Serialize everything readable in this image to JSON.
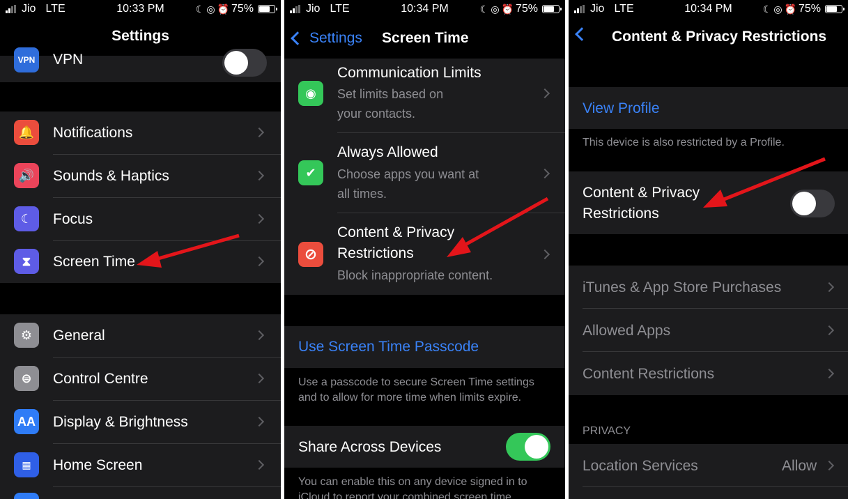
{
  "colors": {
    "accent": "#3a82f7",
    "toggle_on": "#34c759",
    "arrow": "#e3151a"
  },
  "panel1": {
    "status": {
      "carrier": "Jio",
      "network": "LTE",
      "time": "10:33 PM",
      "battery": "75%"
    },
    "title": "Settings",
    "vpn_label": "VPN",
    "items": [
      {
        "label": "Notifications",
        "icon": "notifications-icon"
      },
      {
        "label": "Sounds & Haptics",
        "icon": "sounds-icon"
      },
      {
        "label": "Focus",
        "icon": "focus-moon-icon"
      },
      {
        "label": "Screen Time",
        "icon": "hourglass-icon"
      },
      {
        "label": "General",
        "icon": "gear-icon"
      },
      {
        "label": "Control Centre",
        "icon": "control-centre-icon"
      },
      {
        "label": "Display & Brightness",
        "icon": "display-icon",
        "icon_text": "AA"
      },
      {
        "label": "Home Screen",
        "icon": "home-screen-icon"
      }
    ]
  },
  "panel2": {
    "status": {
      "carrier": "Jio",
      "network": "LTE",
      "time": "10:34 PM",
      "battery": "75%"
    },
    "back_label": "Settings",
    "title": "Screen Time",
    "items": [
      {
        "label": "Communication Limits",
        "sub1": "Set limits based on",
        "sub2": "your contacts.",
        "icon": "person-circle-icon"
      },
      {
        "label": "Always Allowed",
        "sub1": "Choose apps you want at",
        "sub2": "all times.",
        "icon": "checkmark-badge-icon"
      },
      {
        "label1": "Content & Privacy",
        "label2": "Restrictions",
        "sub": "Block inappropriate content.",
        "icon": "no-entry-icon"
      }
    ],
    "passcode_link": "Use Screen Time Passcode",
    "passcode_foot1": "Use a passcode to secure Screen Time settings",
    "passcode_foot2": "and to allow for more time when limits expire.",
    "share_label": "Share Across Devices",
    "share_on": true,
    "share_foot1": "You can enable this on any device signed in to",
    "share_foot2": "iCloud to report your combined screen time."
  },
  "panel3": {
    "status": {
      "carrier": "Jio",
      "network": "LTE",
      "time": "10:34 PM",
      "battery": "75%"
    },
    "title": "Content & Privacy Restrictions",
    "view_profile": "View Profile",
    "profile_foot": "This device is also restricted by a Profile.",
    "toggle_label1": "Content & Privacy",
    "toggle_label2": "Restrictions",
    "toggle_on": false,
    "items": [
      {
        "label": "iTunes & App Store Purchases"
      },
      {
        "label": "Allowed Apps"
      },
      {
        "label": "Content Restrictions"
      }
    ],
    "privacy_header": "PRIVACY",
    "location_label": "Location Services",
    "location_value": "Allow"
  }
}
